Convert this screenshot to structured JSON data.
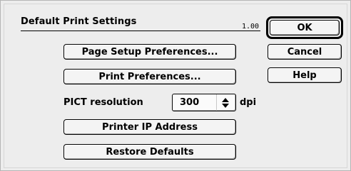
{
  "dialog": {
    "title": "Default Print Settings",
    "version": "1.00"
  },
  "buttons": {
    "page_setup": "Page Setup Preferences...",
    "print_prefs": "Print Preferences...",
    "printer_ip": "Printer IP Address",
    "restore_defaults": "Restore Defaults",
    "ok": "OK",
    "cancel": "Cancel",
    "help": "Help"
  },
  "pict": {
    "label": "PICT resolution",
    "value": "300",
    "unit": "dpi"
  }
}
